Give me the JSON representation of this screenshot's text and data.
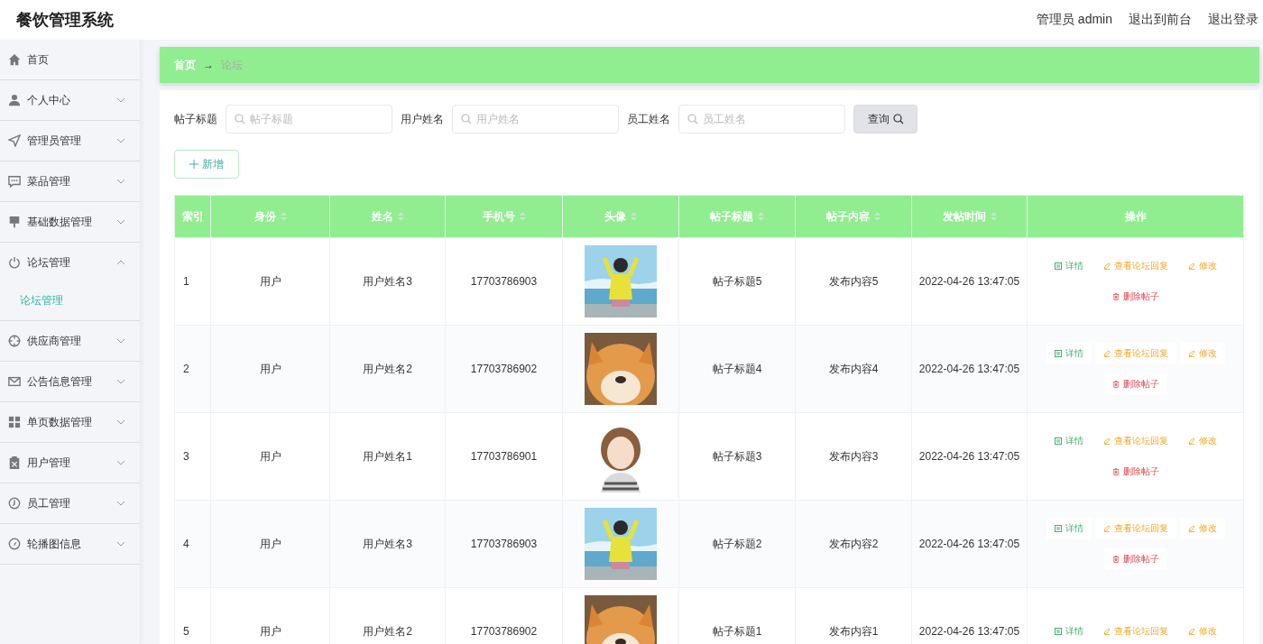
{
  "header": {
    "title": "餐饮管理系统",
    "links": [
      "管理员 admin",
      "退出到前台",
      "退出登录"
    ]
  },
  "sidebar": {
    "items": [
      {
        "label": "首页",
        "kind": "link"
      },
      {
        "label": "个人中心",
        "kind": "submenu",
        "expanded": false
      },
      {
        "label": "管理员管理",
        "kind": "submenu",
        "expanded": false
      },
      {
        "label": "菜品管理",
        "kind": "submenu",
        "expanded": false
      },
      {
        "label": "基础数据管理",
        "kind": "submenu",
        "expanded": false
      },
      {
        "label": "论坛管理",
        "kind": "submenu",
        "expanded": true,
        "children": [
          {
            "label": "论坛管理",
            "selected": true
          }
        ]
      },
      {
        "label": "供应商管理",
        "kind": "submenu",
        "expanded": false
      },
      {
        "label": "公告信息管理",
        "kind": "submenu",
        "expanded": false
      },
      {
        "label": "单页数据管理",
        "kind": "submenu",
        "expanded": false
      },
      {
        "label": "用户管理",
        "kind": "submenu",
        "expanded": false
      },
      {
        "label": "员工管理",
        "kind": "submenu",
        "expanded": false
      },
      {
        "label": "轮播图信息",
        "kind": "submenu",
        "expanded": false
      }
    ]
  },
  "breadcrumb": {
    "items": [
      "首页",
      "论坛"
    ],
    "separator": "→"
  },
  "search": {
    "fields": [
      {
        "label": "帖子标题",
        "placeholder": "帖子标题"
      },
      {
        "label": "用户姓名",
        "placeholder": "用户姓名"
      },
      {
        "label": "员工姓名",
        "placeholder": "员工姓名"
      }
    ],
    "button": "查询"
  },
  "add_button": "新增",
  "table": {
    "columns": [
      {
        "label": "索引",
        "sortable": false
      },
      {
        "label": "身份",
        "sortable": true
      },
      {
        "label": "姓名",
        "sortable": true
      },
      {
        "label": "手机号",
        "sortable": true
      },
      {
        "label": "头像",
        "sortable": true
      },
      {
        "label": "帖子标题",
        "sortable": true
      },
      {
        "label": "帖子内容",
        "sortable": true
      },
      {
        "label": "发帖时间",
        "sortable": true
      },
      {
        "label": "操作",
        "sortable": false
      }
    ],
    "rows": [
      {
        "cells": [
          "1",
          "用户",
          "用户姓名3",
          "17703786903",
          {
            "kind": "picture"
          },
          "帖子标题5",
          "发布内容5",
          "2022-04-26 13:47:05"
        ],
        "actions": [
          {
            "kind": "detail",
            "label": "详情"
          },
          {
            "kind": "reply",
            "label": "查看论坛回复"
          },
          {
            "kind": "edit",
            "label": "修改"
          },
          {
            "kind": "delete",
            "label": "删除帖子"
          }
        ]
      },
      {
        "cells": [
          "2",
          "用户",
          "用户姓名2",
          "17703786902",
          {
            "kind": "picture"
          },
          "帖子标题4",
          "发布内容4",
          "2022-04-26 13:47:05"
        ],
        "actions": [
          {
            "kind": "detail",
            "label": "详情"
          },
          {
            "kind": "reply",
            "label": "查看论坛回复"
          },
          {
            "kind": "edit",
            "label": "修改"
          },
          {
            "kind": "delete",
            "label": "删除帖子"
          }
        ]
      },
      {
        "cells": [
          "3",
          "用户",
          "用户姓名1",
          "17703786901",
          {
            "kind": "picture"
          },
          "帖子标题3",
          "发布内容3",
          "2022-04-26 13:47:05"
        ],
        "actions": [
          {
            "kind": "detail",
            "label": "详情"
          },
          {
            "kind": "reply",
            "label": "查看论坛回复"
          },
          {
            "kind": "edit",
            "label": "修改"
          },
          {
            "kind": "delete",
            "label": "删除帖子"
          }
        ]
      },
      {
        "cells": [
          "4",
          "用户",
          "用户姓名3",
          "17703786903",
          {
            "kind": "picture"
          },
          "帖子标题2",
          "发布内容2",
          "2022-04-26 13:47:05"
        ],
        "actions": [
          {
            "kind": "detail",
            "label": "详情"
          },
          {
            "kind": "reply",
            "label": "查看论坛回复"
          },
          {
            "kind": "edit",
            "label": "修改"
          },
          {
            "kind": "delete",
            "label": "删除帖子"
          }
        ]
      },
      {
        "cells": [
          "5",
          "用户",
          "用户姓名2",
          "17703786902",
          {
            "kind": "picture"
          },
          "帖子标题1",
          "发布内容1",
          "2022-04-26 13:47:05"
        ],
        "actions": [
          {
            "kind": "detail",
            "label": "详情"
          },
          {
            "kind": "reply",
            "label": "查看论坛回复"
          },
          {
            "kind": "edit",
            "label": "修改"
          }
        ]
      }
    ]
  }
}
